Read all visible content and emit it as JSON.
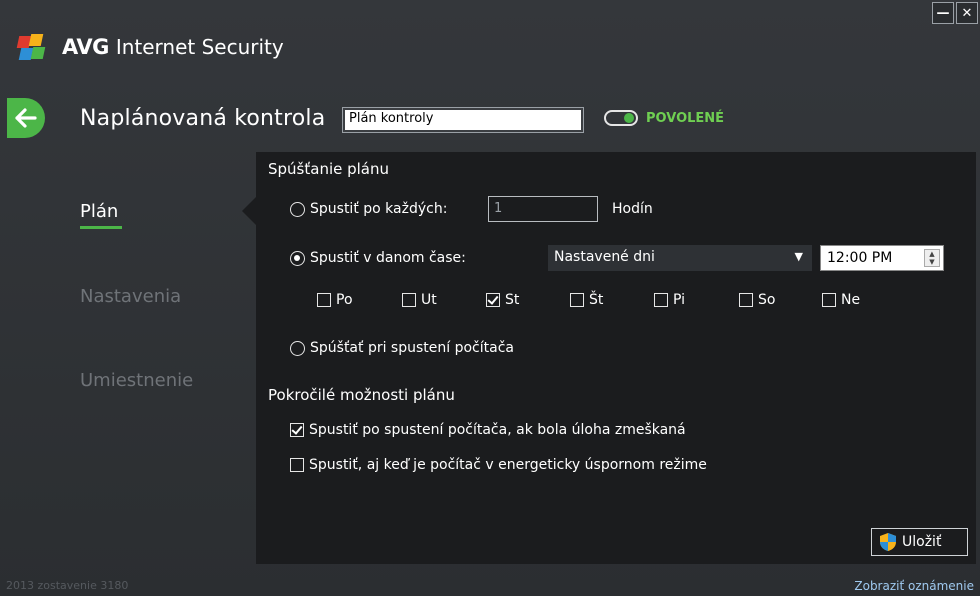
{
  "app": {
    "brand_avg": "AVG",
    "brand_product": "Internet Security",
    "minimize_label": "—",
    "close_label": "✕"
  },
  "header": {
    "title": "Naplánovaná kontrola",
    "name_value": "Plán kontroly",
    "toggle_label": "POVOLENÉ",
    "toggle_on": true
  },
  "nav": {
    "items": [
      {
        "label": "Plán",
        "active": true
      },
      {
        "label": "Nastavenia",
        "active": false
      },
      {
        "label": "Umiestnenie",
        "active": false
      }
    ]
  },
  "schedule": {
    "section_title": "Spúšťanie plánu",
    "run_every_label": "Spustiť po každých:",
    "run_every_value": "1",
    "hours_label": "Hodín",
    "run_at_label": "Spustiť v danom čase:",
    "run_at_selected": "Nastavené dni",
    "time_value": "12:00 PM",
    "days": [
      {
        "label": "Po",
        "checked": false
      },
      {
        "label": "Ut",
        "checked": false
      },
      {
        "label": "St",
        "checked": true
      },
      {
        "label": "Št",
        "checked": false
      },
      {
        "label": "Pi",
        "checked": false
      },
      {
        "label": "So",
        "checked": false
      },
      {
        "label": "Ne",
        "checked": false
      }
    ],
    "run_on_startup_label": "Spúšťať pri spustení počítača",
    "selected_option": "run_at"
  },
  "advanced": {
    "section_title": "Pokročilé možnosti plánu",
    "missed_label": "Spustiť po spustení počítača, ak bola úloha zmeškaná",
    "missed_checked": true,
    "power_save_label": "Spustiť, aj keď je počítač v energeticky úspornom režime",
    "power_save_checked": false
  },
  "actions": {
    "save_label": "Uložiť"
  },
  "footer": {
    "build_text": "2013 zostavenie 3180",
    "notifications_link": "Zobraziť oznámenie"
  },
  "colors": {
    "accent": "#4cb648",
    "background": "#2e3135",
    "panel": "#1b1c1e",
    "link": "#9fc9ef"
  }
}
